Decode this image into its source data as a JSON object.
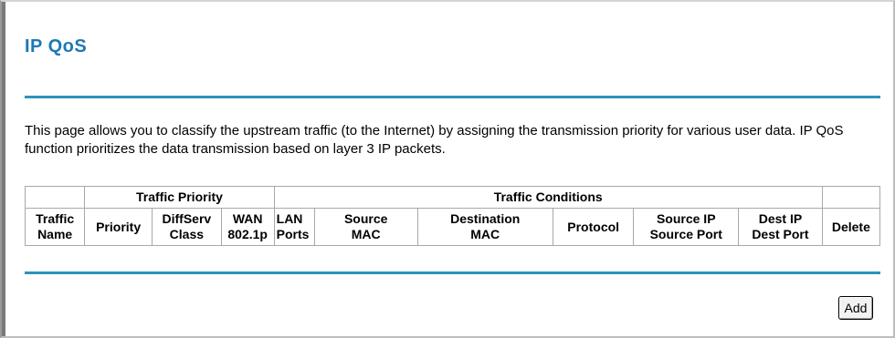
{
  "page": {
    "title": "IP QoS",
    "description": "This page allows you to classify the upstream traffic (to the Internet) by assigning the transmission priority for various user data. IP QoS function prioritizes the data transmission based on layer 3 IP packets."
  },
  "table": {
    "groups": {
      "traffic_priority": "Traffic Priority",
      "traffic_conditions": "Traffic Conditions"
    },
    "columns": [
      {
        "key": "traffic_name",
        "line1": "Traffic",
        "line2": "Name"
      },
      {
        "key": "priority",
        "line1": "Priority",
        "line2": ""
      },
      {
        "key": "diffserv_class",
        "line1": "DiffServ",
        "line2": "Class"
      },
      {
        "key": "wan_8021p",
        "line1": "WAN",
        "line2": "802.1p"
      },
      {
        "key": "lan_ports",
        "line1": "LAN",
        "line2": "Ports"
      },
      {
        "key": "source_mac",
        "line1": "Source",
        "line2": "MAC"
      },
      {
        "key": "destination_mac",
        "line1": "Destination",
        "line2": "MAC"
      },
      {
        "key": "protocol",
        "line1": "Protocol",
        "line2": ""
      },
      {
        "key": "source_ip_port",
        "line1": "Source IP",
        "line2": "Source Port"
      },
      {
        "key": "dest_ip_port",
        "line1": "Dest IP",
        "line2": "Dest Port"
      },
      {
        "key": "delete",
        "line1": "Delete",
        "line2": ""
      }
    ],
    "rows": []
  },
  "buttons": {
    "add_label": "Add"
  },
  "colors": {
    "title": "#1e78b4",
    "rule": "#2c93b9",
    "cell_border": "#a8a8a8"
  }
}
